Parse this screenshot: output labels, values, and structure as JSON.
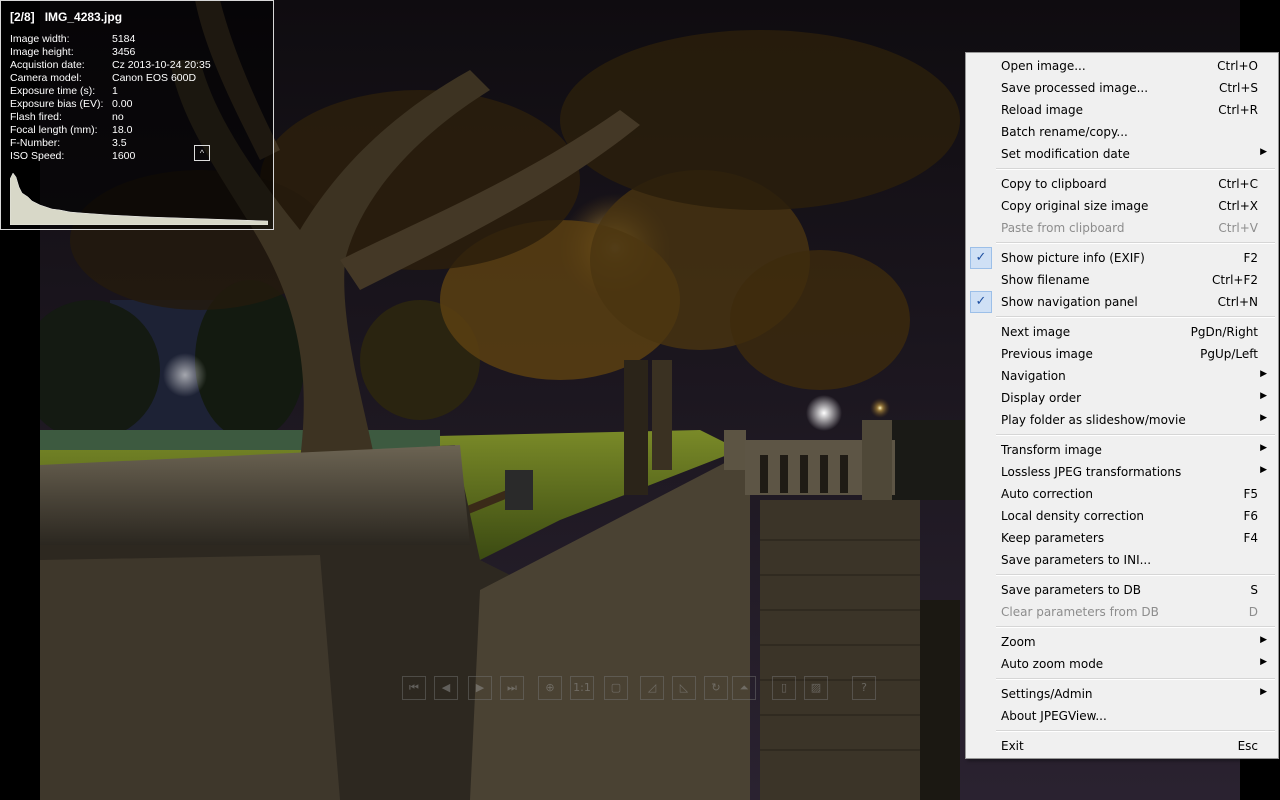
{
  "exif": {
    "counter": "[2/8]",
    "filename": "IMG_4283.jpg",
    "rows": [
      {
        "key": "Image width:",
        "value": "5184"
      },
      {
        "key": "Image height:",
        "value": "3456"
      },
      {
        "key": "Acquistion date:",
        "value": "Cz 2013-10-24 20:35"
      },
      {
        "key": "Camera model:",
        "value": "Canon EOS 600D"
      },
      {
        "key": "Exposure time (s):",
        "value": "1"
      },
      {
        "key": "Exposure bias (EV):",
        "value": "0.00"
      },
      {
        "key": "Flash fired:",
        "value": "no"
      },
      {
        "key": "Focal length (mm):",
        "value": "18.0"
      },
      {
        "key": "F-Number:",
        "value": "3.5"
      },
      {
        "key": "ISO Speed:",
        "value": "1600"
      }
    ],
    "collapse_glyph": "^"
  },
  "nav_panel": {
    "buttons": [
      "first-image",
      "previous-image",
      "next-image",
      "last-image",
      "zoom-in",
      "actual-size",
      "fit-window",
      "rotate-left-lossless",
      "rotate-right-lossless",
      "rotate",
      "perspective",
      "show-info",
      "keep-params",
      "help"
    ],
    "glyphs": [
      "⏮",
      "◀",
      "▶",
      "⏭",
      "⊕",
      "1:1",
      "▢",
      "◿",
      "◺",
      "↻",
      "⏶",
      "▯",
      "▨",
      "?"
    ]
  },
  "menu": {
    "items": [
      {
        "label": "Open image...",
        "shortcut": "Ctrl+O"
      },
      {
        "label": "Save processed image...",
        "shortcut": "Ctrl+S"
      },
      {
        "label": "Reload image",
        "shortcut": "Ctrl+R"
      },
      {
        "label": "Batch rename/copy...",
        "shortcut": ""
      },
      {
        "label": "Set modification date",
        "shortcut": "",
        "submenu": true
      },
      {
        "separator": true
      },
      {
        "label": "Copy to clipboard",
        "shortcut": "Ctrl+C"
      },
      {
        "label": "Copy original size image",
        "shortcut": "Ctrl+X"
      },
      {
        "label": "Paste from clipboard",
        "shortcut": "Ctrl+V",
        "disabled": true
      },
      {
        "separator": true
      },
      {
        "label": "Show picture info (EXIF)",
        "shortcut": "F2",
        "checked": true
      },
      {
        "label": "Show filename",
        "shortcut": "Ctrl+F2"
      },
      {
        "label": "Show navigation panel",
        "shortcut": "Ctrl+N",
        "checked": true
      },
      {
        "separator": true
      },
      {
        "label": "Next image",
        "shortcut": "PgDn/Right"
      },
      {
        "label": "Previous image",
        "shortcut": "PgUp/Left"
      },
      {
        "label": "Navigation",
        "shortcut": "",
        "submenu": true
      },
      {
        "label": "Display order",
        "shortcut": "",
        "submenu": true
      },
      {
        "label": "Play folder as slideshow/movie",
        "shortcut": "",
        "submenu": true
      },
      {
        "separator": true
      },
      {
        "label": "Transform image",
        "shortcut": "",
        "submenu": true
      },
      {
        "label": "Lossless JPEG transformations",
        "shortcut": "",
        "submenu": true
      },
      {
        "label": "Auto correction",
        "shortcut": "F5"
      },
      {
        "label": "Local density correction",
        "shortcut": "F6"
      },
      {
        "label": "Keep parameters",
        "shortcut": "F4"
      },
      {
        "label": "Save parameters to INI...",
        "shortcut": ""
      },
      {
        "separator": true
      },
      {
        "label": "Save parameters to DB",
        "shortcut": "S"
      },
      {
        "label": "Clear parameters from DB",
        "shortcut": "D",
        "disabled": true
      },
      {
        "separator": true
      },
      {
        "label": "Zoom",
        "shortcut": "",
        "submenu": true
      },
      {
        "label": "Auto zoom mode",
        "shortcut": "",
        "submenu": true
      },
      {
        "separator": true
      },
      {
        "label": "Settings/Admin",
        "shortcut": "",
        "submenu": true
      },
      {
        "label": "About JPEGView...",
        "shortcut": ""
      },
      {
        "separator": true
      },
      {
        "label": "Exit",
        "shortcut": "Esc"
      }
    ],
    "submenu_glyph": "▶",
    "check_glyph": "✓"
  },
  "colors": {
    "menu_bg": "#f0f0f0",
    "menu_disabled": "#8d8d8d",
    "check_bg": "#cfe0f5",
    "panel_border": "#d8d8d8"
  }
}
